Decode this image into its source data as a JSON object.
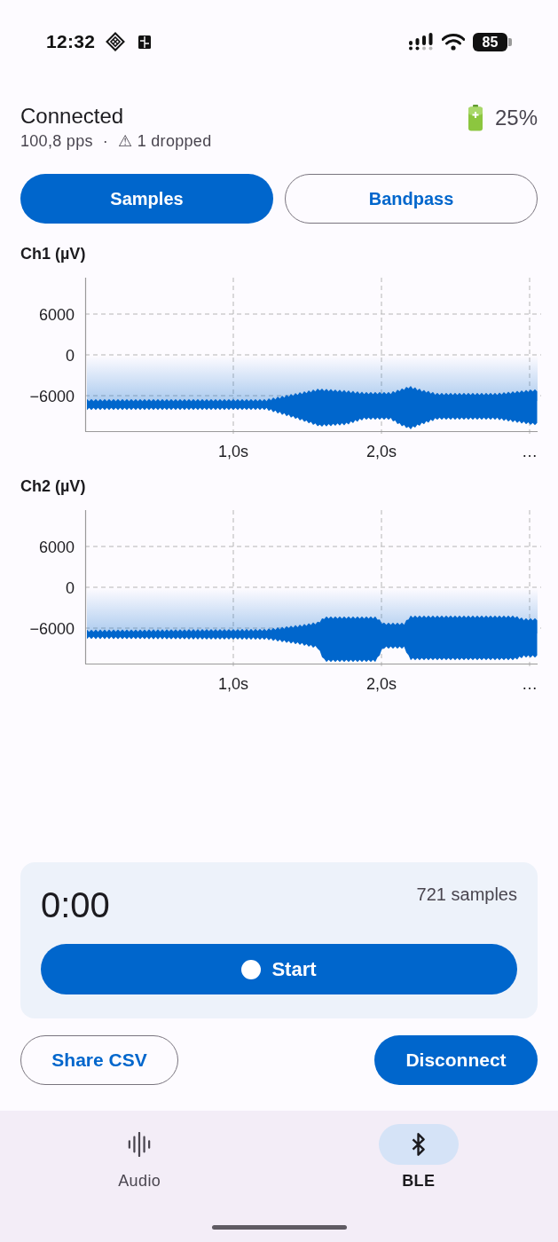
{
  "status_bar": {
    "time": "12:32",
    "battery": "85"
  },
  "header": {
    "title": "Connected",
    "rate": "100,8 pps",
    "separator": "·",
    "dropped": "⚠ 1 dropped",
    "battery": "25%"
  },
  "view_toggle": [
    {
      "label": "Samples",
      "selected": true
    },
    {
      "label": "Bandpass",
      "selected": false
    }
  ],
  "charts": [
    {
      "title": "Ch1 (µV)",
      "y_ticks": [
        "6000",
        "0",
        "−6000"
      ],
      "x_ticks": [
        "1,0s",
        "2,0s",
        "…"
      ]
    },
    {
      "title": "Ch2 (µV)",
      "y_ticks": [
        "6000",
        "0",
        "−6000"
      ],
      "x_ticks": [
        "1,0s",
        "2,0s",
        "…"
      ]
    }
  ],
  "recording": {
    "elapsed": "0:00",
    "samples": "721 samples",
    "start_button": "Start"
  },
  "actions": [
    {
      "label": "Share CSV",
      "kind": "outlined"
    },
    {
      "label": "Disconnect",
      "kind": "filled"
    }
  ],
  "bottom_nav": [
    {
      "label": "Audio",
      "selected": false
    },
    {
      "label": "BLE",
      "selected": true
    }
  ]
}
